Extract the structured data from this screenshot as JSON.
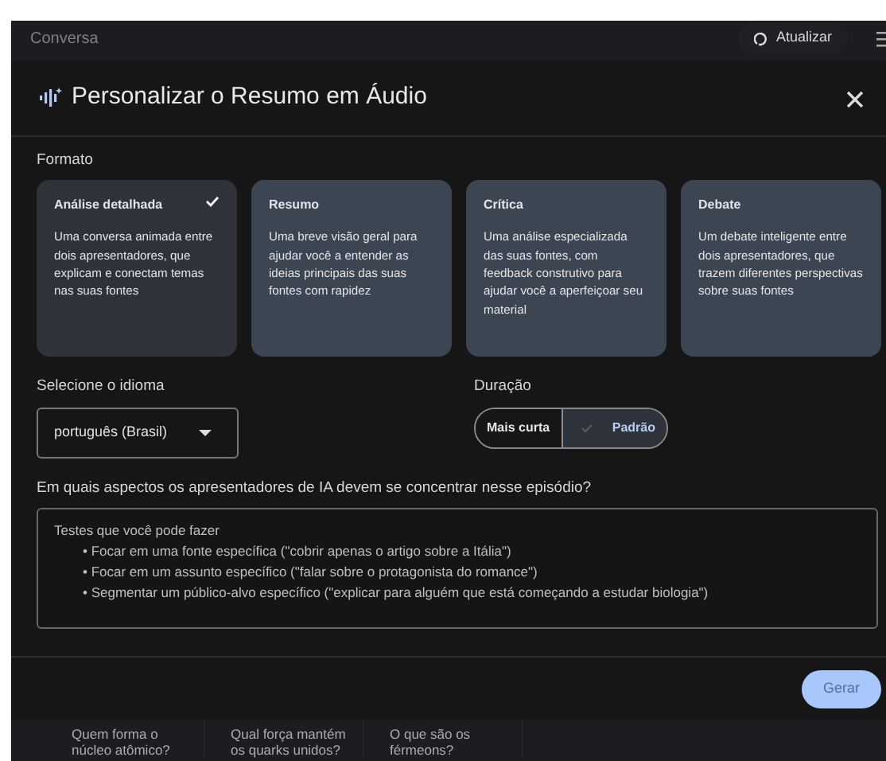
{
  "background": {
    "header_title": "Conversa",
    "refresh_button": "Atualizar"
  },
  "dialog": {
    "title": "Personalizar o Resumo em Áudio",
    "format_label": "Formato",
    "formats": [
      {
        "title": "Análise detalhada",
        "description": "Uma conversa animada entre dois apresentadores, que explicam e conectam temas nas suas fontes",
        "selected": true
      },
      {
        "title": "Resumo",
        "description": "Uma breve visão geral para ajudar você a entender as ideias principais das suas fontes com rapidez",
        "selected": false
      },
      {
        "title": "Crítica",
        "description": "Uma análise especializada das suas fontes, com feedback construtivo para ajudar você a aperfeiçoar seu material",
        "selected": false
      },
      {
        "title": "Debate",
        "description": "Um debate inteligente entre dois apresentadores, que trazem diferentes perspectivas sobre suas fontes",
        "selected": false
      }
    ],
    "language_label": "Selecione o idioma",
    "language_value": "português (Brasil)",
    "duration_label": "Duração",
    "durations": [
      {
        "label": "Mais curta",
        "selected": false
      },
      {
        "label": "Padrão",
        "selected": true
      }
    ],
    "focus_question": "Em quais aspectos os apresentadores de IA devem se concentrar nesse episódio?",
    "focus_placeholder": {
      "heading": "Testes que você pode fazer",
      "items": [
        "• Focar em uma fonte específica (\"cobrir apenas o artigo sobre a Itália\")",
        "• Focar em um assunto específico (\"falar sobre o protagonista do romance\")",
        "• Segmentar um público-alvo específico (\"explicar para alguém que está começando a estudar biologia\")"
      ]
    },
    "generate_button": {
      "label": "Gerar",
      "disabled": true
    }
  },
  "suggestions": [
    "Quem forma o núcleo atômico?",
    "Qual força mantém os quarks unidos?",
    "O que são os férmeons?"
  ]
}
